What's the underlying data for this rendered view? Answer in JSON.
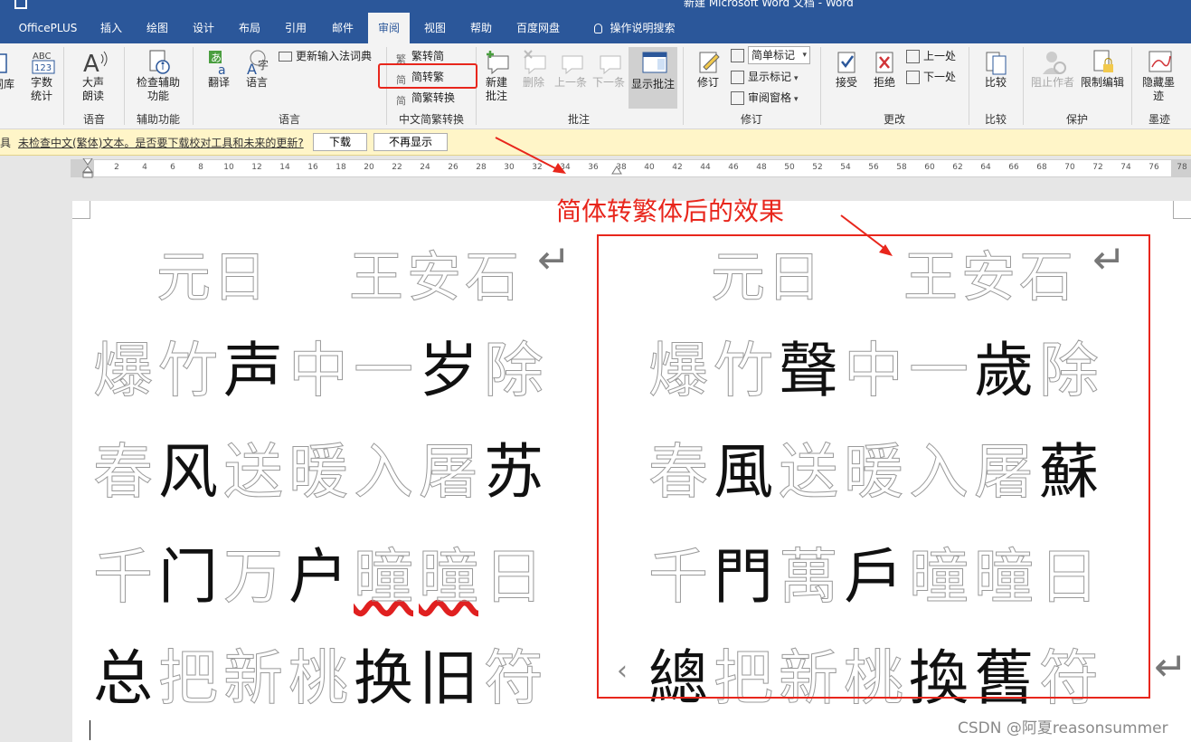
{
  "window": {
    "title": "新建 Microsoft Word 文档 - Word"
  },
  "tabs": [
    {
      "label": "OfficePLUS",
      "active": false
    },
    {
      "label": "插入",
      "active": false
    },
    {
      "label": "绘图",
      "active": false
    },
    {
      "label": "设计",
      "active": false
    },
    {
      "label": "布局",
      "active": false
    },
    {
      "label": "引用",
      "active": false
    },
    {
      "label": "邮件",
      "active": false
    },
    {
      "label": "审阅",
      "active": true
    },
    {
      "label": "视图",
      "active": false
    },
    {
      "label": "帮助",
      "active": false
    },
    {
      "label": "百度网盘",
      "active": false
    },
    {
      "label": "操作说明搜索",
      "active": false,
      "icon": "lightbulb-icon"
    }
  ],
  "ribbon": {
    "proofing": {
      "partial_label": "词库",
      "word_count_icon": "ABC 123",
      "word_count": "字数统计"
    },
    "speech": {
      "read_aloud": "大声朗读",
      "group": "语音"
    },
    "accessibility": {
      "check": "检查辅助功能",
      "group": "辅助功能"
    },
    "language": {
      "translate": "翻译",
      "language": "语言",
      "update_ime": "更新输入法词典",
      "group": "语言"
    },
    "chinese_conversion": {
      "trad_to_simp": "繁转简",
      "simp_to_trad": "简转繁",
      "convert": "简繁转换",
      "group": "中文简繁转换"
    },
    "comments": {
      "new": "新建批注",
      "delete": "删除",
      "previous": "上一条",
      "next": "下一条",
      "show": "显示批注",
      "group": "批注"
    },
    "tracking": {
      "track": "修订",
      "markup_select": "简单标记",
      "show_markup": "显示标记",
      "review_pane": "审阅窗格",
      "group": "修订"
    },
    "changes": {
      "accept": "接受",
      "reject": "拒绝",
      "previous": "上一处",
      "next": "下一处",
      "group": "更改"
    },
    "compare": {
      "compare": "比较",
      "group": "比较"
    },
    "protect": {
      "block_authors": "阻止作者",
      "restrict": "限制编辑",
      "group": "保护"
    },
    "ink": {
      "hide_ink": "隐藏墨迹",
      "group": "墨迹"
    }
  },
  "message_bar": {
    "prefix": "具",
    "text": "未检查中文(繁体)文本。是否要下载校对工具和未来的更新?",
    "download": "下载",
    "dont_show": "不再显示"
  },
  "ruler": {
    "ticks": [
      "2",
      "4",
      "6",
      "8",
      "10",
      "12",
      "14",
      "16",
      "18",
      "20",
      "22",
      "24",
      "26",
      "28",
      "30",
      "32",
      "34",
      "36",
      "38",
      "40",
      "42",
      "44",
      "46",
      "48",
      "50",
      "52",
      "54",
      "56",
      "58",
      "60",
      "62",
      "64",
      "66",
      "68",
      "70",
      "72",
      "74",
      "76",
      "78"
    ]
  },
  "document": {
    "left": {
      "title_chars": [
        "元",
        "日"
      ],
      "author_chars": [
        "王",
        "安",
        "石"
      ],
      "lines": [
        [
          {
            "c": "爆",
            "s": false
          },
          {
            "c": "竹",
            "s": false
          },
          {
            "c": "声",
            "s": true
          },
          {
            "c": "中",
            "s": false
          },
          {
            "c": "一",
            "s": false
          },
          {
            "c": "岁",
            "s": true
          },
          {
            "c": "除",
            "s": false
          }
        ],
        [
          {
            "c": "春",
            "s": false
          },
          {
            "c": "风",
            "s": true
          },
          {
            "c": "送",
            "s": false
          },
          {
            "c": "暖",
            "s": false
          },
          {
            "c": "入",
            "s": false
          },
          {
            "c": "屠",
            "s": false
          },
          {
            "c": "苏",
            "s": true
          }
        ],
        [
          {
            "c": "千",
            "s": false
          },
          {
            "c": "门",
            "s": true
          },
          {
            "c": "万",
            "s": false
          },
          {
            "c": "户",
            "s": true
          },
          {
            "c": "曈",
            "s": false
          },
          {
            "c": "曈",
            "s": false
          },
          {
            "c": "日",
            "s": false
          }
        ],
        [
          {
            "c": "总",
            "s": true
          },
          {
            "c": "把",
            "s": false
          },
          {
            "c": "新",
            "s": false
          },
          {
            "c": "桃",
            "s": false
          },
          {
            "c": "换",
            "s": true
          },
          {
            "c": "旧",
            "s": true
          },
          {
            "c": "符",
            "s": false
          }
        ]
      ]
    },
    "right": {
      "title_chars": [
        "元",
        "日"
      ],
      "author_chars": [
        "王",
        "安",
        "石"
      ],
      "lines": [
        [
          {
            "c": "爆",
            "s": false
          },
          {
            "c": "竹",
            "s": false
          },
          {
            "c": "聲",
            "s": true
          },
          {
            "c": "中",
            "s": false
          },
          {
            "c": "一",
            "s": false
          },
          {
            "c": "歲",
            "s": true
          },
          {
            "c": "除",
            "s": false
          }
        ],
        [
          {
            "c": "春",
            "s": false
          },
          {
            "c": "風",
            "s": true
          },
          {
            "c": "送",
            "s": false
          },
          {
            "c": "暖",
            "s": false
          },
          {
            "c": "入",
            "s": false
          },
          {
            "c": "屠",
            "s": false
          },
          {
            "c": "蘇",
            "s": true
          }
        ],
        [
          {
            "c": "千",
            "s": false
          },
          {
            "c": "門",
            "s": true
          },
          {
            "c": "萬",
            "s": false
          },
          {
            "c": "戶",
            "s": true
          },
          {
            "c": "曈",
            "s": false
          },
          {
            "c": "曈",
            "s": false
          },
          {
            "c": "日",
            "s": false
          }
        ],
        [
          {
            "c": "總",
            "s": true
          },
          {
            "c": "把",
            "s": false
          },
          {
            "c": "新",
            "s": false
          },
          {
            "c": "桃",
            "s": false
          },
          {
            "c": "換",
            "s": true
          },
          {
            "c": "舊",
            "s": true
          },
          {
            "c": "符",
            "s": false
          }
        ]
      ]
    },
    "return_mark": "↵",
    "annotation": "简体转繁体后的效果",
    "watermark": "CSDN @阿夏reasonsummer"
  },
  "colors": {
    "accent": "#2b579a",
    "highlight": "#e8261c",
    "message_bar": "#fff5c8"
  }
}
